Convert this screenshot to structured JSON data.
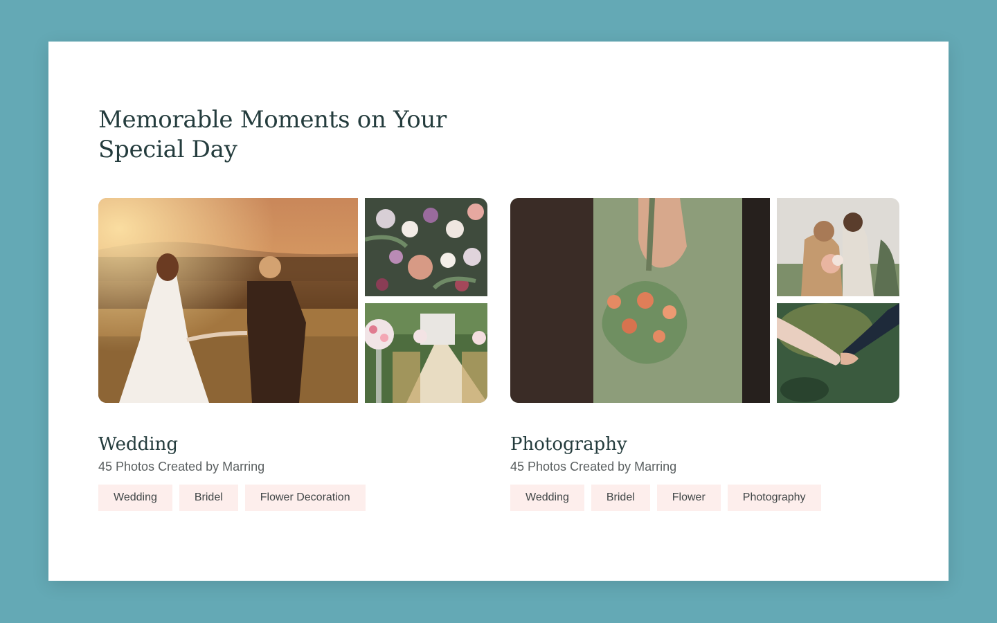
{
  "section": {
    "title": "Memorable Moments on Your Special Day"
  },
  "albums": [
    {
      "name": "Wedding",
      "meta": "45 Photos Created by Marring",
      "tags": [
        "Wedding",
        "Bridel",
        "Flower Decoration"
      ],
      "photos": [
        "couple-walking-sunset-photo",
        "bridal-bouquet-photo",
        "ceremony-aisle-photo"
      ]
    },
    {
      "name": "Photography",
      "meta": "45 Photos Created by Marring",
      "tags": [
        "Wedding",
        "Bridel",
        "Flower",
        "Photography"
      ],
      "photos": [
        "holding-hands-bouquet-photo",
        "couple-embrace-photo",
        "hands-touching-photo"
      ]
    }
  ],
  "colors": {
    "background": "#64a9b5",
    "card": "#ffffff",
    "heading": "#243c3d",
    "tag_background": "#fdeeec"
  }
}
